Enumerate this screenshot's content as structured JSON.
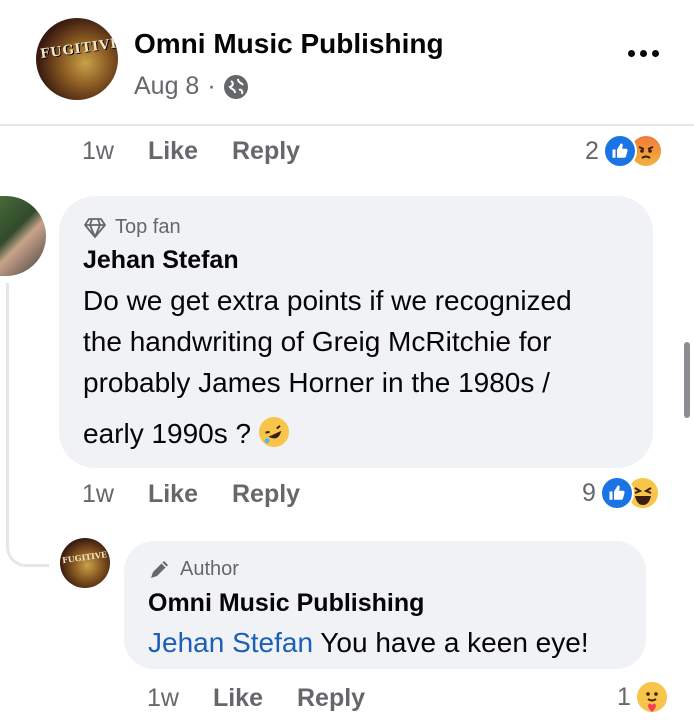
{
  "post": {
    "page_name": "Omni Music Publishing",
    "date": "Aug 8",
    "separator": "·",
    "avatar_text": "FUGITIVE"
  },
  "first_action_row": {
    "time": "1w",
    "like": "Like",
    "reply": "Reply",
    "reaction_count": "2",
    "reactions": [
      "like-icon",
      "angry-icon"
    ]
  },
  "comment": {
    "badge": "Top fan",
    "author": "Jehan Stefan",
    "lines": [
      "Do we get extra points if we recognized",
      "the handwriting of Greig McRitchie for",
      "probably James Horner in the 1980s /",
      "early 1990s ?"
    ],
    "time": "1w",
    "like": "Like",
    "reply": "Reply",
    "reaction_count": "9",
    "reactions": [
      "like-icon",
      "haha-icon"
    ]
  },
  "reply": {
    "badge": "Author",
    "author": "Omni Music Publishing",
    "mention": "Jehan Stefan",
    "text": " You have a keen eye!",
    "avatar_text": "FUGITIVE",
    "time": "1w",
    "like": "Like",
    "reply": "Reply",
    "reaction_count": "1",
    "reactions": [
      "care-icon"
    ]
  },
  "colors": {
    "accent_blue": "#1b74e4",
    "mention_blue": "#1b5fb6",
    "secondary_text": "#65676b",
    "bubble_bg": "#f0f2f5"
  }
}
